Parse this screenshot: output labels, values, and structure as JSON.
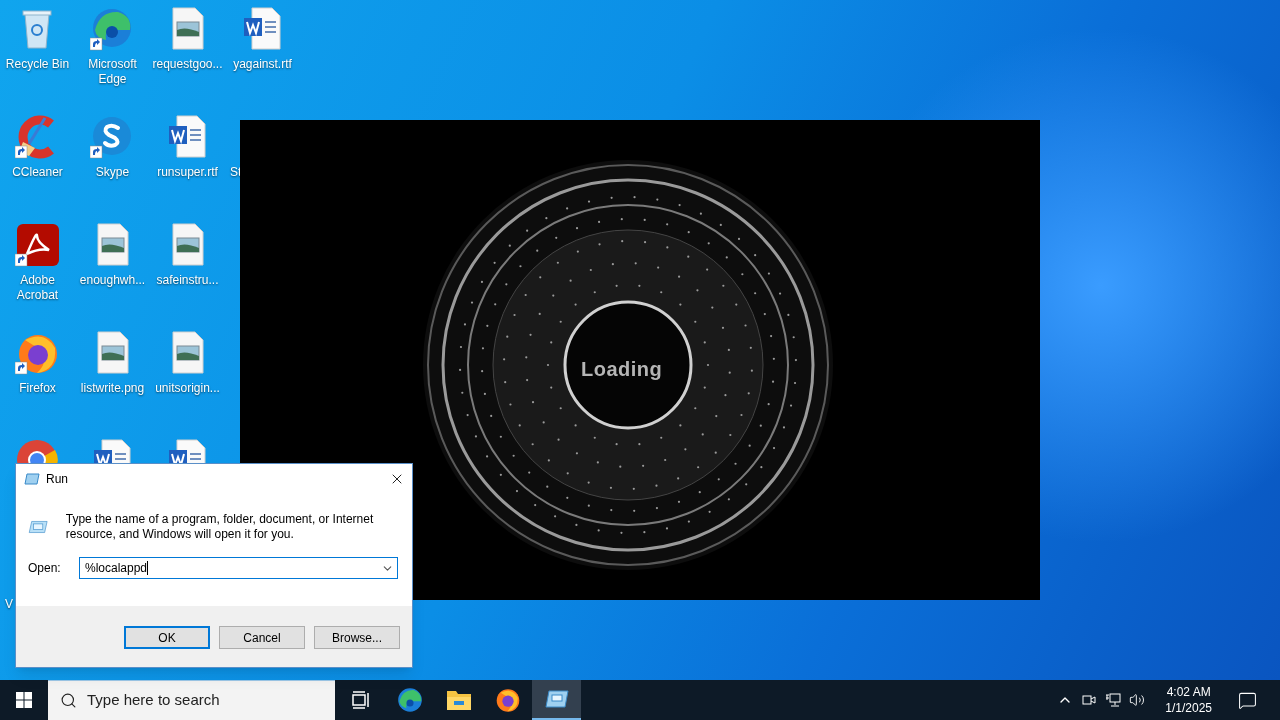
{
  "desktop_columns": [
    [
      {
        "label": "Recycle Bin",
        "kind": "recycle",
        "shortcut": false
      },
      {
        "label": "CCleaner",
        "kind": "ccleaner",
        "shortcut": true
      },
      {
        "label": "Adobe Acrobat",
        "kind": "acrobat",
        "shortcut": true
      },
      {
        "label": "Firefox",
        "kind": "firefox",
        "shortcut": true
      },
      {
        "kind": "chrome"
      },
      {
        "label": "V",
        "kind": "partial"
      }
    ],
    [
      {
        "label": "Microsoft Edge",
        "kind": "edge",
        "shortcut": true
      },
      {
        "label": "Skype",
        "kind": "skype",
        "shortcut": true
      },
      {
        "label": "enoughwh...",
        "kind": "image",
        "shortcut": false
      },
      {
        "label": "listwrite.png",
        "kind": "image",
        "shortcut": false
      },
      {
        "kind": "word"
      }
    ],
    [
      {
        "label": "requestgoo...",
        "kind": "image",
        "shortcut": false
      },
      {
        "label": "runsuper.rtf",
        "kind": "word",
        "shortcut": false
      },
      {
        "label": "safeinstru...",
        "kind": "image",
        "shortcut": false
      },
      {
        "label": "unitsorigin...",
        "kind": "image",
        "shortcut": false
      },
      {
        "kind": "word"
      }
    ],
    [
      {
        "label": "yagainst.rtf",
        "kind": "word",
        "shortcut": false
      },
      {
        "label": "St",
        "kind": "partial"
      }
    ]
  ],
  "splash_window": {
    "label": "Loading"
  },
  "run_dialog": {
    "title": "Run",
    "message": "Type the name of a program, folder, document, or Internet resource, and Windows will open it for you.",
    "open_label": "Open:",
    "open_value": "%localappd",
    "buttons": [
      {
        "label": "OK",
        "default": true
      },
      {
        "label": "Cancel",
        "default": false
      },
      {
        "label": "Browse...",
        "default": false
      }
    ]
  },
  "taskbar": {
    "search": {
      "placeholder": "Type here to search"
    },
    "apps": [
      {
        "kind": "taskview",
        "selected": false
      },
      {
        "kind": "edge",
        "selected": false
      },
      {
        "kind": "explorer",
        "selected": false
      },
      {
        "kind": "firefox",
        "selected": false
      },
      {
        "kind": "run",
        "selected": true
      }
    ],
    "time": "4:02 AM",
    "date": "1/1/2025"
  }
}
